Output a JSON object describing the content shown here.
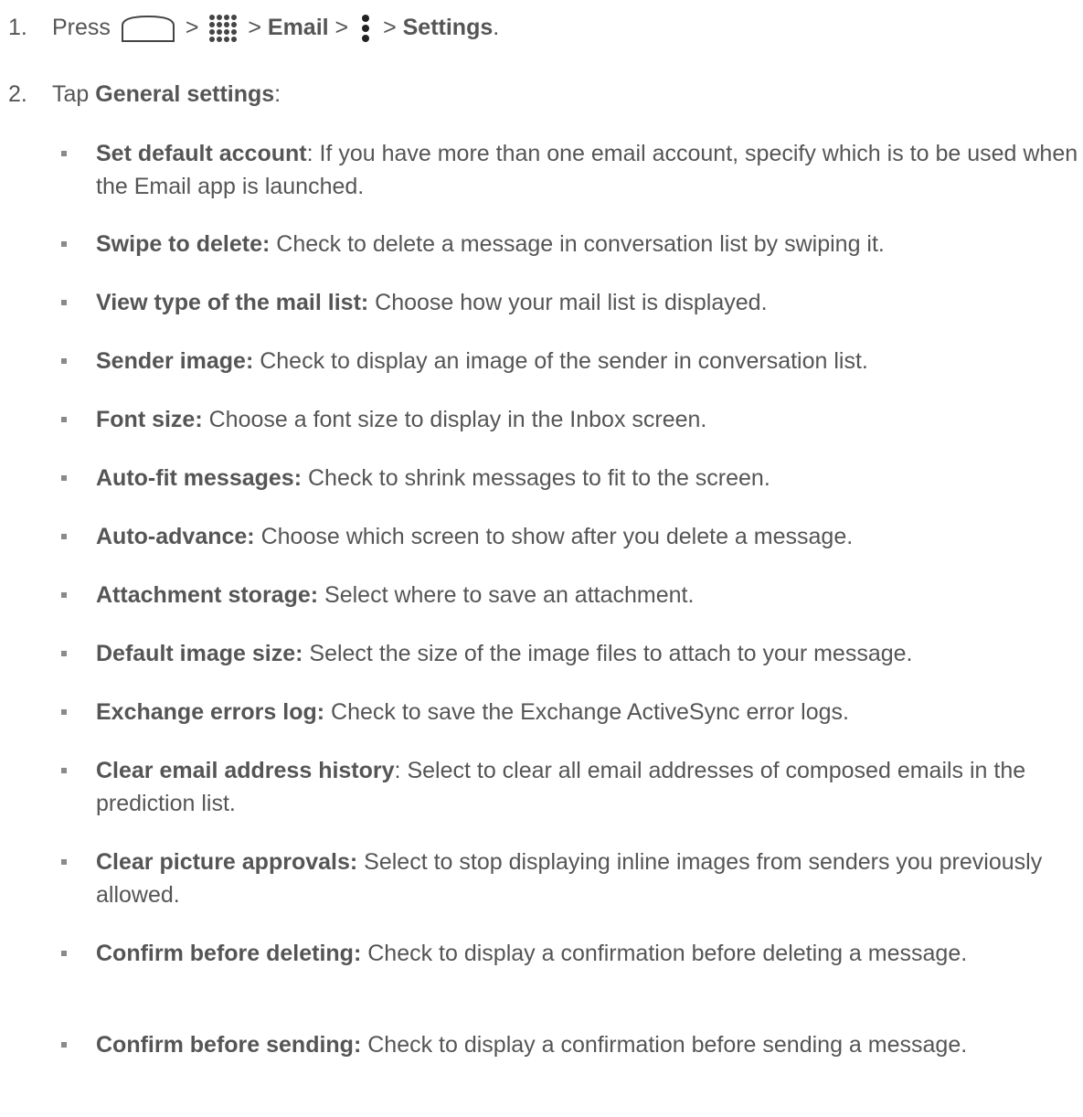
{
  "steps": [
    {
      "number": "1.",
      "text_press": "Press",
      "sep1": ">",
      "sep2": ">",
      "email": "Email",
      "sep3": ">",
      "sep4": ">",
      "settings": "Settings",
      "end": ".",
      "icons": [
        "home-icon",
        "apps-icon",
        "menu-icon"
      ]
    },
    {
      "number": "2.",
      "text_tap": "Tap",
      "general_settings": "General settings",
      "colon": ":"
    }
  ],
  "bullets": [
    {
      "term": "Set default account",
      "desc": ": If you have more than one email account, specify which is to be used when the Email app is launched."
    },
    {
      "term": "Swipe to delete:",
      "desc": " Check to delete a message in conversation list by swiping it."
    },
    {
      "term": "View type of the mail list:",
      "desc": " Choose how your mail list is displayed."
    },
    {
      "term": "Sender image:",
      "desc": " Check to display an image of the sender in conversation list."
    },
    {
      "term": "Font size:",
      "desc": " Choose a font size to display in the Inbox screen."
    },
    {
      "term": "Auto-fit messages:",
      "desc": " Check to shrink messages to fit to the screen."
    },
    {
      "term": "Auto-advance:",
      "desc": " Choose which screen to show after you delete a message."
    },
    {
      "term": "Attachment storage:",
      "desc": " Select where to save an attachment."
    },
    {
      "term": "Default image size:",
      "desc": " Select the size of the image files to attach to your message."
    },
    {
      "term": "Exchange errors log:",
      "desc": " Check to save the Exchange ActiveSync error logs."
    },
    {
      "term": "Clear email address history",
      "desc": ": Select to clear all email addresses of composed emails in the prediction list."
    },
    {
      "term": "Clear picture approvals:",
      "desc": " Select to stop displaying inline images from senders you previously allowed."
    },
    {
      "term": "Confirm before deleting:",
      "desc": " Check to display a confirmation before deleting a message."
    },
    {
      "term": "Confirm before sending:",
      "desc": " Check to display a confirmation before sending a message."
    }
  ]
}
